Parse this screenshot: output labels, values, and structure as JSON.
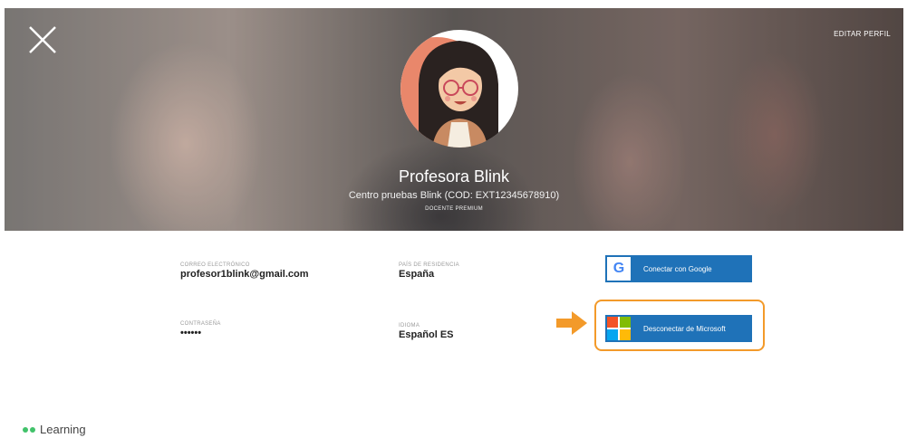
{
  "header": {
    "edit_profile_label": "EDITAR PERFIL"
  },
  "profile": {
    "name": "Profesora Blink",
    "center": "Centro pruebas Blink (COD: EXT12345678910)",
    "badge": "DOCENTE PREMIUM"
  },
  "fields": {
    "email": {
      "label": "CORREO ELECTRÓNICO",
      "value": "profesor1blink@gmail.com"
    },
    "country": {
      "label": "PAÍS DE RESIDENCIA",
      "value": "España"
    },
    "password": {
      "label": "CONTRASEÑA",
      "value": "••••••"
    },
    "language": {
      "label": "IDIOMA",
      "value": "Español ES"
    }
  },
  "buttons": {
    "google": {
      "label": "Conectar con Google",
      "icon": "google-icon"
    },
    "microsoft": {
      "label": "Desconectar de Microsoft",
      "icon": "microsoft-icon"
    }
  },
  "footer": {
    "brand": "Learning"
  },
  "colors": {
    "button_blue": "#1f72b8",
    "highlight_orange": "#f39a2a",
    "brand_green": "#41c26a"
  }
}
